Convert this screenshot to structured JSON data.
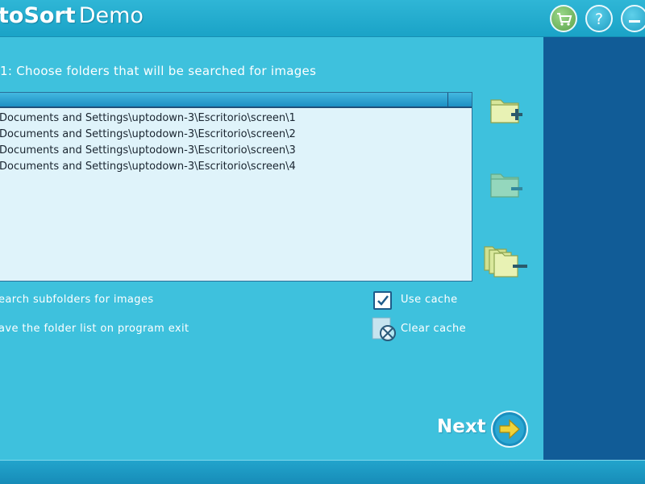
{
  "window": {
    "title_bold": "toSort",
    "title_light": "Demo",
    "accent": "#3ec1dd",
    "panel_color": "#115c97"
  },
  "toolbar": {
    "icons": [
      "cart-icon",
      "help-icon",
      "minimize-icon"
    ]
  },
  "step": {
    "label": "1:  Choose folders that will be searched for images"
  },
  "folder_list": {
    "rows": [
      "Documents and Settings\\uptodown-3\\Escritorio\\screen\\1",
      "Documents and Settings\\uptodown-3\\Escritorio\\screen\\2",
      "Documents and Settings\\uptodown-3\\Escritorio\\screen\\3",
      "Documents and Settings\\uptodown-3\\Escritorio\\screen\\4"
    ]
  },
  "folder_actions": [
    "add-folder-icon",
    "remove-folder-icon",
    "remove-all-folders-icon"
  ],
  "options": {
    "search_subfolders": "earch subfolders for images",
    "save_list": "ave the folder list on program exit",
    "use_cache": "Use cache",
    "use_cache_checked": true,
    "clear_cache": "Clear cache"
  },
  "footer": {
    "next_label": "Next"
  }
}
